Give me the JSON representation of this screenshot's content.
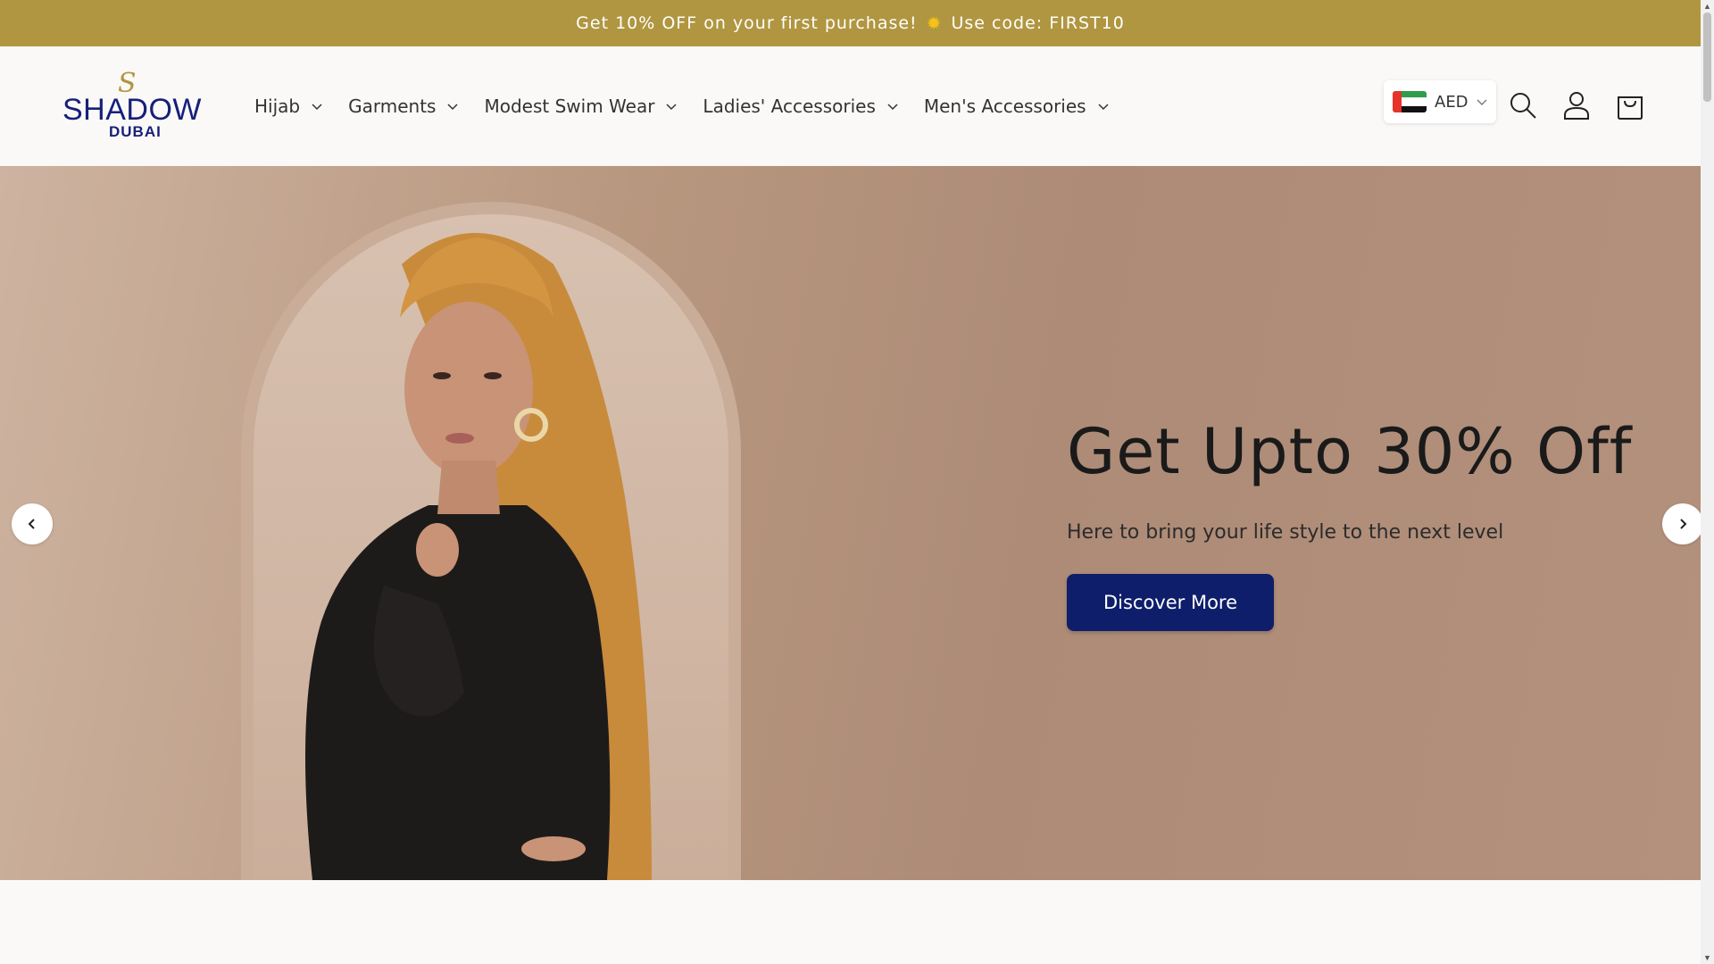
{
  "announcement": {
    "text_before": "Get 10% OFF on your first purchase!",
    "icon": "sun-icon",
    "text_after": "Use code: FIRST10"
  },
  "brand": {
    "monogram": "S",
    "name": "SHADOW",
    "city": "DUBAI"
  },
  "nav": {
    "items": [
      {
        "label": "Hijab"
      },
      {
        "label": "Garments"
      },
      {
        "label": "Modest Swim Wear"
      },
      {
        "label": "Ladies' Accessories"
      },
      {
        "label": "Men's Accessories"
      }
    ]
  },
  "currency": {
    "code": "AED",
    "flag": "uae-flag-icon"
  },
  "header_icons": [
    "search-icon",
    "account-icon",
    "cart-icon"
  ],
  "hero": {
    "title": "Get Upto 30% Off",
    "subtitle": "Here to bring your life style to the next level",
    "button_label": "Discover More"
  },
  "colors": {
    "announcement_bg": "#b09640",
    "brand_navy": "#0e1e6a",
    "page_bg": "#fbf9f7"
  }
}
